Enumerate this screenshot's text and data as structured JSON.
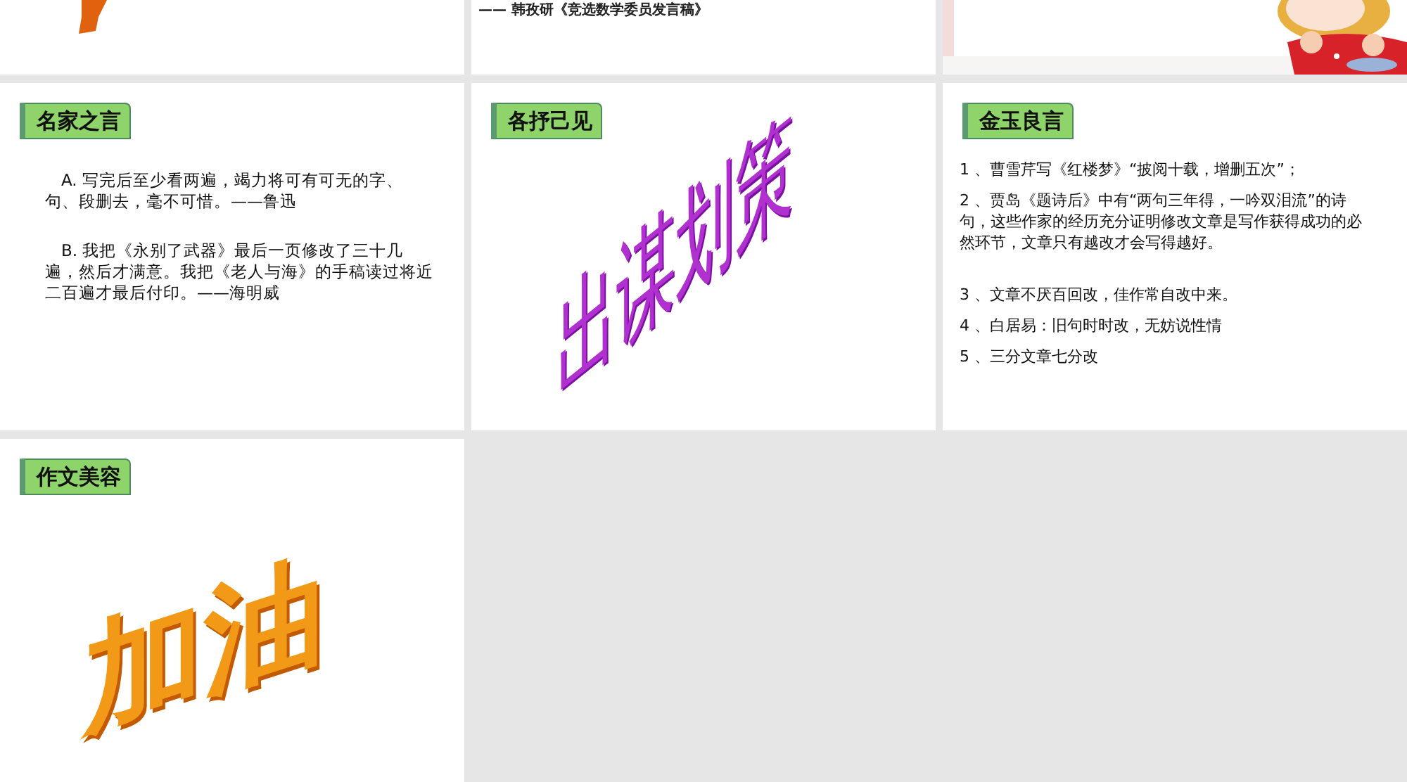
{
  "slides": [
    {
      "kind": "fragment"
    },
    {
      "kind": "caption",
      "caption": "—— 韩孜研《竞选数学委员发言稿》"
    },
    {
      "kind": "picture"
    },
    {
      "kind": "quotes",
      "title": "名家之言",
      "paragraphs": [
        "A. 写完后至少看两遍，竭力将可有可无的字、句、段删去，毫不可惜。——鲁迅",
        "B. 我把《永别了武器》最后一页修改了三十几遍，然后才满意。我把《老人与海》的手稿读过将近二百遍才最后付印。——海明威"
      ]
    },
    {
      "kind": "slantart",
      "title": "各抒己见",
      "art": "出谋划策"
    },
    {
      "kind": "list",
      "title": "金玉良言",
      "items": [
        "1 、曹雪芹写《红楼梦》“披阅十载，增删五次”；",
        "2 、贾岛《题诗后》中有“两句三年得，一吟双泪流”的诗句，这些作家的经历充分证明修改文章是写作获得成功的必然环节，文章只有越改才会写得越好。",
        "3 、文章不厌百回改，佳作常自改中来。",
        "4 、白居易：旧句时时改，无妨说性情",
        "5 、三分文章七分改"
      ]
    },
    {
      "kind": "boldart",
      "title": "作文美容",
      "art": "加油"
    }
  ]
}
